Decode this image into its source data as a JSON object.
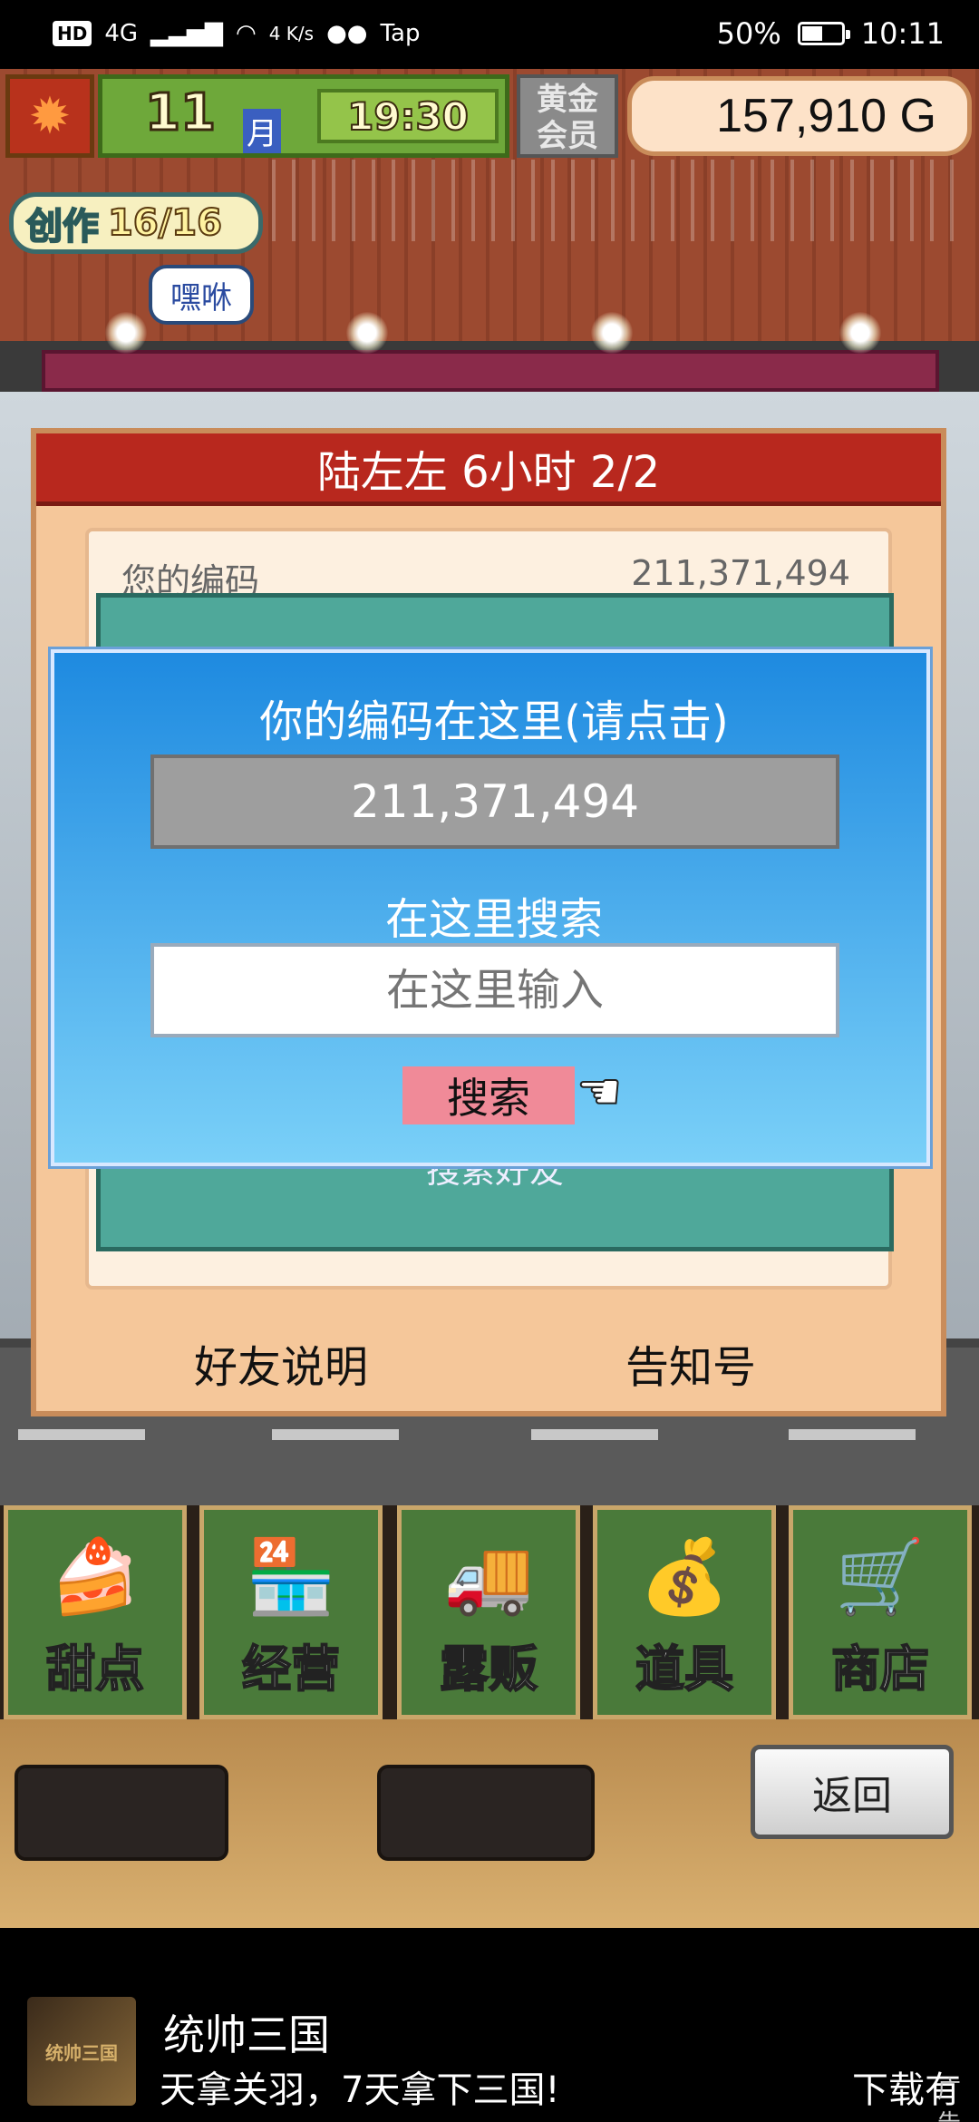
{
  "status_bar": {
    "left_badge": "HD",
    "network": "4G",
    "speed": "4 K/s",
    "tap_label": "Tap",
    "battery_percent": "50%",
    "battery_level": 0.5,
    "time": "10:11"
  },
  "hud": {
    "month_number": "11",
    "month_label": "月",
    "clock": "19:30",
    "gold_member": [
      "黄金",
      "会员"
    ],
    "money": "157,910 G",
    "creation_label": "创作",
    "creation_count": "16/16",
    "speech_bubble": "嘿咻"
  },
  "panel": {
    "header": "陆左左  6小时 2/2",
    "code_label": "您的编码",
    "code_value": "211,371,494",
    "search_friend_label": "搜索好友",
    "friend_info_button": "好友说明",
    "notice_button": "告知号"
  },
  "dialog": {
    "title": "你的编码在这里(请点击)",
    "code_display": "211,371,494",
    "search_label": "在这里搜索",
    "search_placeholder": "在这里输入",
    "search_button": "搜索"
  },
  "menu": {
    "items": [
      {
        "label": "甜点",
        "icon": "cake-icon"
      },
      {
        "label": "经营",
        "icon": "shop-icon"
      },
      {
        "label": "露贩",
        "icon": "food-truck-icon"
      },
      {
        "label": "道具",
        "icon": "items-icon"
      },
      {
        "label": "商店",
        "icon": "cart-icon"
      }
    ],
    "back_button": "返回"
  },
  "ad": {
    "image_text": "统帅三国",
    "title": "统帅三国",
    "description": "天拿关羽，7天拿下三国!",
    "download": "下载有",
    "tag": "广告"
  },
  "colors": {
    "panel_header": "#b8281e",
    "dialog_top": "#1e8ae0",
    "search_button": "#f08a98",
    "menu_green": "#4a7a3a"
  }
}
